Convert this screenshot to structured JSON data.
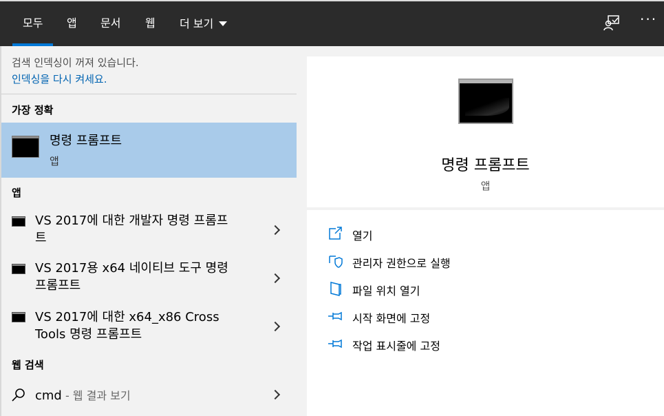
{
  "tabs": [
    {
      "label": "모두",
      "active": true
    },
    {
      "label": "앱",
      "active": false
    },
    {
      "label": "문서",
      "active": false
    },
    {
      "label": "웹",
      "active": false
    },
    {
      "label": "더 보기",
      "active": false
    }
  ],
  "topbar": {
    "feedback_icon": "feedback-icon",
    "more_icon": "ellipsis-icon"
  },
  "notice": {
    "text": "검색 인덱싱이 꺼져 있습니다.",
    "link": "인덱싱을 다시 켜세요."
  },
  "best_match": {
    "section": "가장 정확",
    "name": "명령 프롬프트",
    "type": "앱"
  },
  "apps": {
    "section": "앱",
    "items": [
      {
        "line1": "VS 2017에 대한 개발자 명령 프롬프",
        "line2": "트"
      },
      {
        "line1": "VS 2017용 x64 네이티브 도구 명령",
        "line2": "프롬프트"
      },
      {
        "line1": "VS 2017에 대한 x64_x86 Cross",
        "line2": "Tools 명령 프롬프트"
      }
    ]
  },
  "web": {
    "section": "웹 검색",
    "query": "cmd",
    "suffix": " - 웹 결과 보기"
  },
  "detail": {
    "title": "명령 프롬프트",
    "type": "앱",
    "actions": [
      {
        "label": "열기",
        "icon": "open-icon"
      },
      {
        "label": "관리자 권한으로 실행",
        "icon": "shield-icon"
      },
      {
        "label": "파일 위치 열기",
        "icon": "folder-icon"
      },
      {
        "label": "시작 화면에 고정",
        "icon": "pin-icon"
      },
      {
        "label": "작업 표시줄에 고정",
        "icon": "pin-icon"
      }
    ]
  },
  "colors": {
    "accent": "#0078d7",
    "selected": "#a9cbea",
    "topbar": "#2b2b2b",
    "link": "#0063b1"
  }
}
